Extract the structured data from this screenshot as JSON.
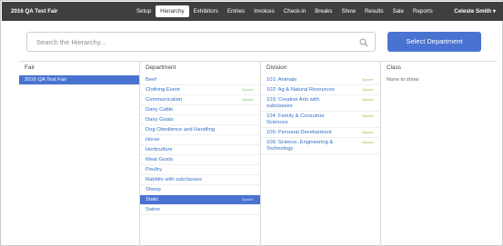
{
  "topbar": {
    "brand": "2016 QA Test Fair",
    "nav": [
      "Setup",
      "Hierarchy",
      "Exhibitors",
      "Entries",
      "Invoices",
      "Check-in",
      "Breaks",
      "Show",
      "Results",
      "Sale",
      "Reports"
    ],
    "active_nav": "Hierarchy",
    "user": "Celeste Smith ▾"
  },
  "search": {
    "placeholder": "Search the Hierarchy...",
    "icon": "search-icon"
  },
  "select_button": "Select Department",
  "columns": {
    "fair": {
      "header": "Fair",
      "items": [
        {
          "label": "2016 QA Test Fair",
          "selected": true
        }
      ]
    },
    "department": {
      "header": "Department",
      "items": [
        {
          "label": "Beef",
          "synced": ""
        },
        {
          "label": "Clothing Event",
          "synced": "Synced"
        },
        {
          "label": "Communication",
          "synced": "Synced"
        },
        {
          "label": "Dairy Cattle",
          "synced": ""
        },
        {
          "label": "Dairy Goats",
          "synced": ""
        },
        {
          "label": "Dog Obedience and Handling",
          "synced": ""
        },
        {
          "label": "Horse",
          "synced": ""
        },
        {
          "label": "Horticulture",
          "synced": ""
        },
        {
          "label": "Meat Goats",
          "synced": ""
        },
        {
          "label": "Poultry",
          "synced": ""
        },
        {
          "label": "Rabbits with subclasses",
          "synced": ""
        },
        {
          "label": "Sheep",
          "synced": ""
        },
        {
          "label": "Static",
          "synced": "Synced",
          "selected": true
        },
        {
          "label": "Swine",
          "synced": ""
        }
      ]
    },
    "division": {
      "header": "Division",
      "items": [
        {
          "label": "101: Animals",
          "synced": "Synced"
        },
        {
          "label": "102: Ag & Natural Resources",
          "synced": "Synced"
        },
        {
          "label": "103: Creative Arts with subclasses",
          "synced": "Synced"
        },
        {
          "label": "104: Family & Consumer Sciences",
          "synced": "Synced"
        },
        {
          "label": "105: Personal Development",
          "synced": "Synced"
        },
        {
          "label": "106: Science, Engineering & Technology",
          "synced": "Synced"
        }
      ]
    },
    "class": {
      "header": "Class",
      "empty_text": "None to show"
    }
  }
}
